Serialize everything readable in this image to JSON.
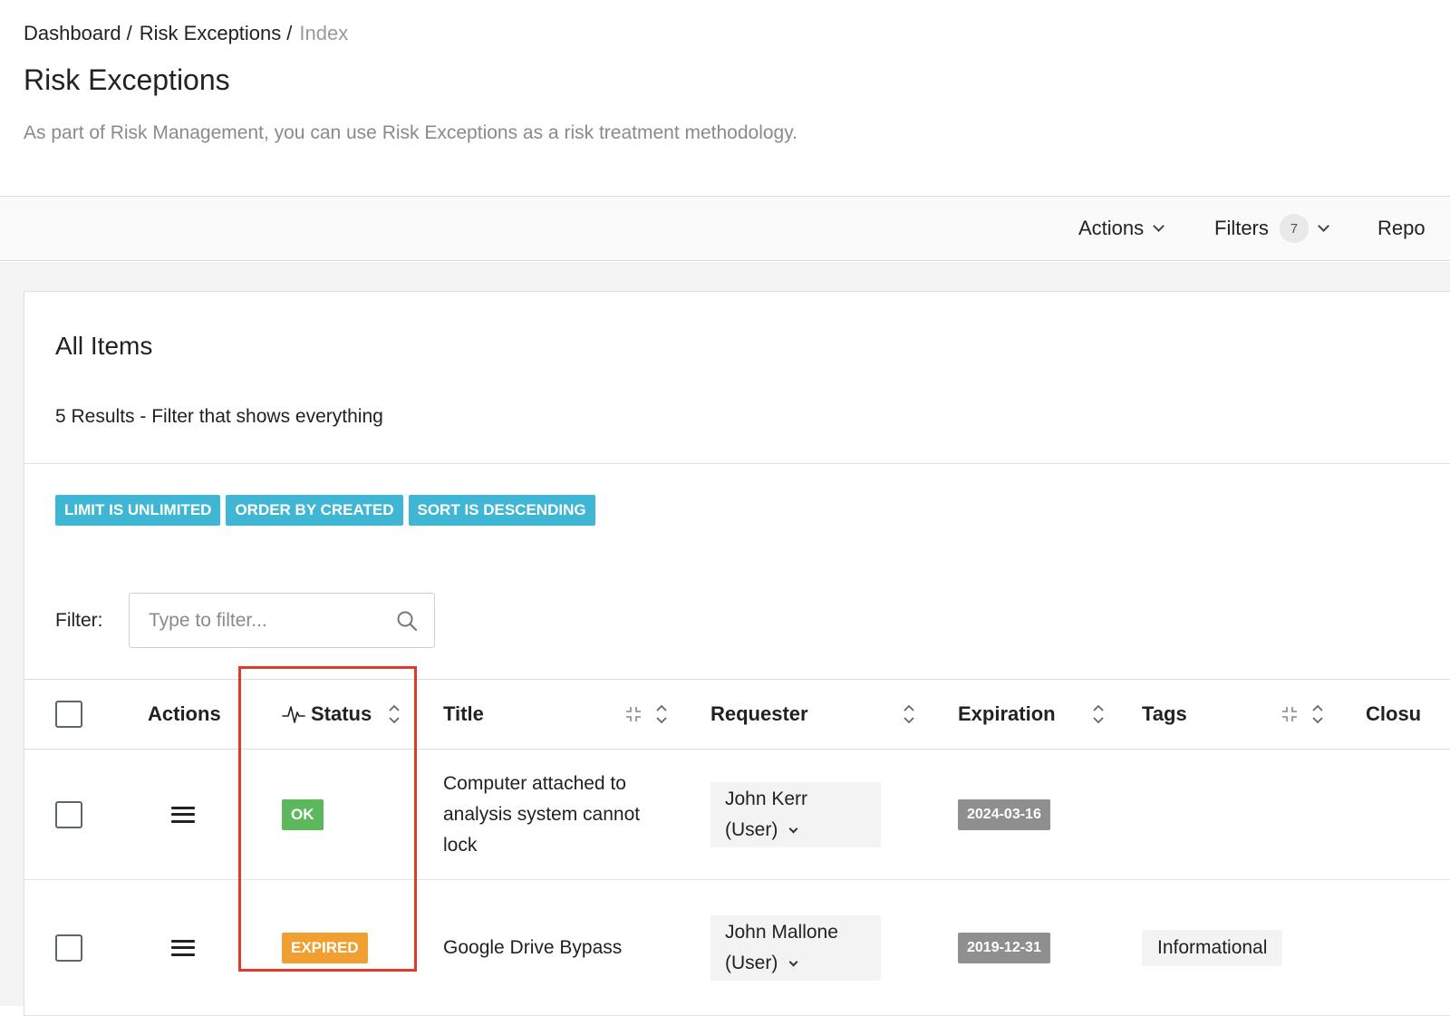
{
  "breadcrumb": {
    "items": [
      "Dashboard",
      "Risk Exceptions"
    ],
    "separator": "/",
    "current": "Index"
  },
  "page": {
    "title": "Risk Exceptions",
    "description": "As part of Risk Management, you can use Risk Exceptions as a risk treatment methodology."
  },
  "toolbar": {
    "actions_label": "Actions",
    "filters_label": "Filters",
    "filters_count": "7",
    "reports_label": "Repo"
  },
  "panel": {
    "title": "All Items",
    "results": "5 Results - Filter that shows everything",
    "chips": [
      "LIMIT IS UNLIMITED",
      "ORDER BY CREATED",
      "SORT IS DESCENDING"
    ],
    "filter_label": "Filter:",
    "filter_placeholder": "Type to filter...",
    "filter_value": ""
  },
  "table": {
    "headers": {
      "actions": "Actions",
      "status": "Status",
      "title": "Title",
      "requester": "Requester",
      "expiration": "Expiration",
      "tags": "Tags",
      "closure": "Closu"
    },
    "rows": [
      {
        "status": "OK",
        "status_color": "#5cb85c",
        "title": "Computer attached to analysis system cannot lock",
        "requester_name": "John Kerr",
        "requester_role": "(User)",
        "expiration": "2024-03-16",
        "tag": ""
      },
      {
        "status": "EXPIRED",
        "status_color": "#f0a030",
        "title": "Google Drive Bypass",
        "requester_name": "John Mallone",
        "requester_role": "(User)",
        "expiration": "2019-12-31",
        "tag": "Informational"
      }
    ]
  },
  "colors": {
    "chip": "#3fb6d3",
    "date_badge": "#8f8f8f",
    "highlight": "#e03a2a"
  },
  "icons": {
    "search": "search-icon",
    "sort": "sort-icon",
    "collapse": "collapse-icon",
    "status": "activity-icon",
    "menu": "hamburger-icon"
  }
}
